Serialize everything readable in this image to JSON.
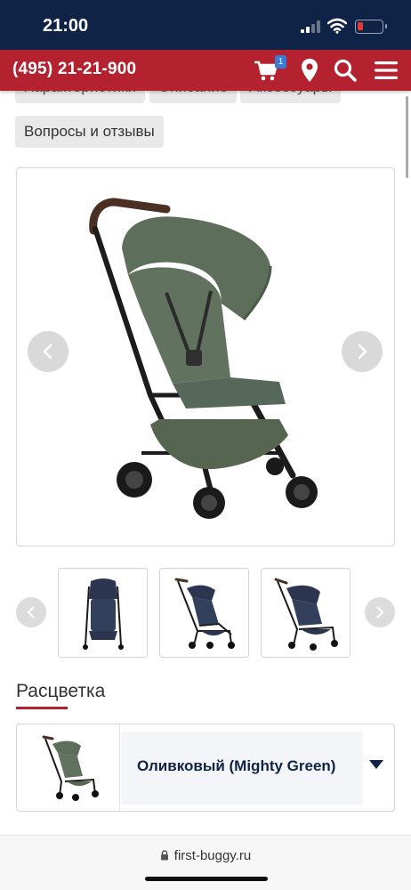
{
  "status_bar": {
    "time": "21:00"
  },
  "header": {
    "phone": "(495) 21-21-900",
    "cart_count": "1"
  },
  "tabs": [
    {
      "label": "Характеристики"
    },
    {
      "label": "Описание"
    },
    {
      "label": "Аксессуары"
    }
  ],
  "questions_tab": {
    "label": "Вопросы и отзывы"
  },
  "colors": {
    "accent_red": "#b5222f",
    "navy": "#0f2346",
    "olive": "#5a6b58"
  },
  "gallery": {
    "icons": {
      "prev": "chevron-left-icon",
      "next": "chevron-right-icon"
    }
  },
  "color_section": {
    "title": "Расцветка",
    "selected": "Оливковый (Mighty Green)"
  },
  "browser": {
    "url": "first-buggy.ru"
  }
}
